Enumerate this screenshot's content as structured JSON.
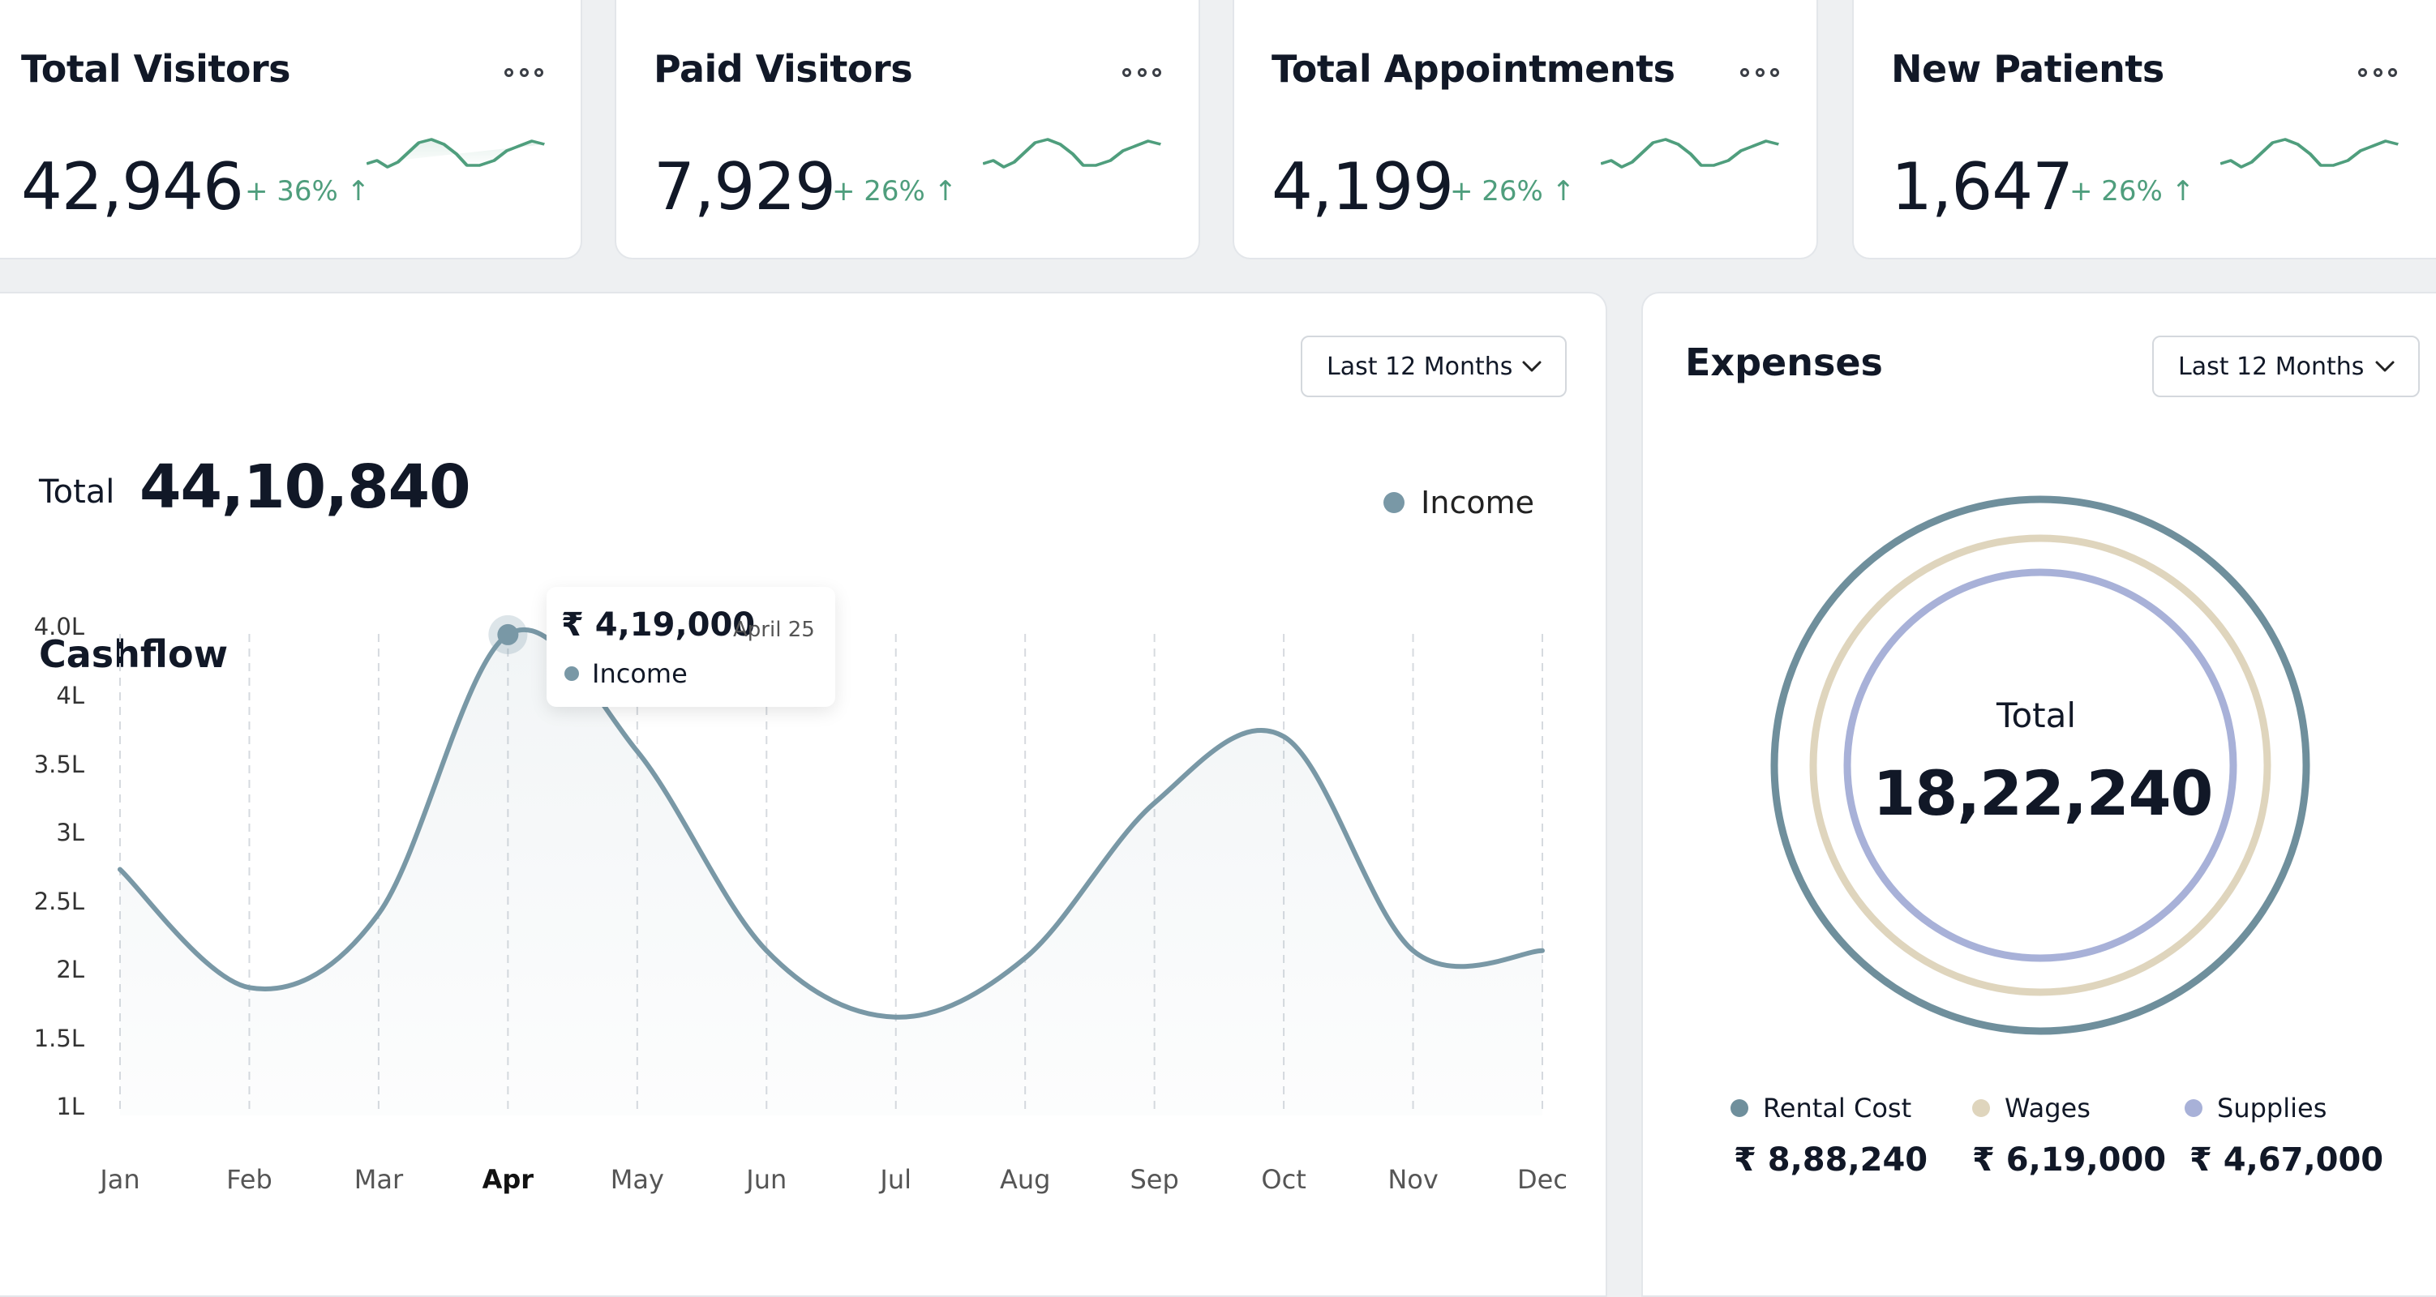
{
  "stats": [
    {
      "title": "Total Visitors",
      "value": "42,946",
      "change": "+ 36%",
      "arrow": "↑"
    },
    {
      "title": "Paid Visitors",
      "value": "7,929",
      "change": "+ 26%",
      "arrow": "↑"
    },
    {
      "title": "Total Appointments",
      "value": "4,199",
      "change": "+ 26%",
      "arrow": "↑"
    },
    {
      "title": "New Patients",
      "value": "1,647",
      "change": "+ 26%",
      "arrow": "↑"
    }
  ],
  "colors": {
    "income": "#7998a6",
    "positive": "#4f9e7d",
    "rental": "#6f8f9c",
    "wages": "#dfd5bd",
    "supplies": "#a8b1d8"
  },
  "cashflow": {
    "title": "Cashflow",
    "range_label": "Last 12 Months",
    "total_label": "Total",
    "total_value": "44,10,840",
    "legend_label": "Income",
    "tooltip": {
      "value": "₹ 4,19,000",
      "date": "April 25",
      "series": "Income"
    }
  },
  "expenses": {
    "title": "Expenses",
    "range_label": "Last 12 Months",
    "total_label": "Total",
    "total_value": "18,22,240",
    "items": [
      {
        "label": "Rental Cost",
        "value": "₹ 8,88,240"
      },
      {
        "label": "Wages",
        "value": "₹ 6,19,000"
      },
      {
        "label": "Supplies",
        "value": "₹ 4,67,000"
      }
    ]
  },
  "chart_data": [
    {
      "type": "area",
      "categories": [
        "Jan",
        "Feb",
        "Mar",
        "Apr",
        "May",
        "Jun",
        "Jul",
        "Aug",
        "Sep",
        "Oct",
        "Nov",
        "Dec"
      ],
      "highlighted_category": "Apr",
      "y_ticks": [
        "4.0L",
        "4L",
        "3.5L",
        "3L",
        "2.5L",
        "2L",
        "1.5L",
        "1L"
      ],
      "series": [
        {
          "name": "Income",
          "values": [
            2.6,
            1.8,
            2.3,
            4.19,
            3.4,
            2.05,
            1.6,
            2.0,
            3.05,
            3.5,
            2.05,
            2.05
          ]
        }
      ],
      "ylim": [
        1.0,
        4.25
      ],
      "grid": "vertical-dashed"
    },
    {
      "type": "pie",
      "style": "concentric-rings",
      "labels": [
        "Rental Cost",
        "Wages",
        "Supplies"
      ],
      "values": [
        888240,
        619000,
        467000
      ]
    }
  ]
}
